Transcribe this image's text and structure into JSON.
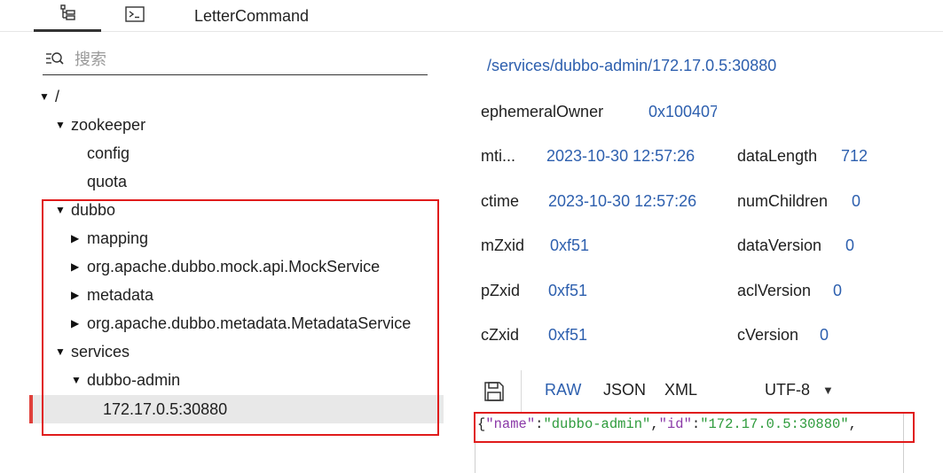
{
  "tabs": {
    "tree_icon": "tree-icon",
    "terminal_icon": "terminal-icon",
    "letter_label": "LetterCommand"
  },
  "search": {
    "placeholder": "搜索",
    "value": ""
  },
  "tree": {
    "root": "/",
    "zookeeper": "zookeeper",
    "config": "config",
    "quota": "quota",
    "dubbo": "dubbo",
    "mapping": "mapping",
    "mock_service": "org.apache.dubbo.mock.api.MockService",
    "metadata": "metadata",
    "metadata_service": "org.apache.dubbo.metadata.MetadataService",
    "services": "services",
    "dubbo_admin": "dubbo-admin",
    "selected_node": "172.17.0.5:30880"
  },
  "details": {
    "path": "/services/dubbo-admin/172.17.0.5:30880",
    "ephemeralOwner": {
      "label": "ephemeralOwner",
      "value": "0x100407"
    },
    "mtime": {
      "label": "mti...",
      "value": "2023-10-30 12:57:26"
    },
    "dataLength": {
      "label": "dataLength",
      "value": "712"
    },
    "ctime": {
      "label": "ctime",
      "value": "2023-10-30 12:57:26"
    },
    "numChildren": {
      "label": "numChildren",
      "value": "0"
    },
    "mZxid": {
      "label": "mZxid",
      "value": "0xf51"
    },
    "dataVersion": {
      "label": "dataVersion",
      "value": "0"
    },
    "pZxid": {
      "label": "pZxid",
      "value": "0xf51"
    },
    "aclVersion": {
      "label": "aclVersion",
      "value": "0"
    },
    "cZxid": {
      "label": "cZxid",
      "value": "0xf51"
    },
    "cVersion": {
      "label": "cVersion",
      "value": "0"
    }
  },
  "viewer": {
    "formats": {
      "raw": "RAW",
      "json": "JSON",
      "xml": "XML"
    },
    "active_format": "RAW",
    "encoding": "UTF-8",
    "code": {
      "open": "{",
      "key1": "\"name\"",
      "colon": ":",
      "val1": "\"dubbo-admin\"",
      "comma": ",",
      "key2": "\"id\"",
      "val2": "\"172.17.0.5:30880\""
    }
  },
  "colors": {
    "accent_blue": "#2d5fae",
    "highlight_red": "#e01b1b",
    "selected_bg": "#e8e8e8",
    "json_key": "#8b3aa8",
    "json_string": "#2e9b3c"
  }
}
